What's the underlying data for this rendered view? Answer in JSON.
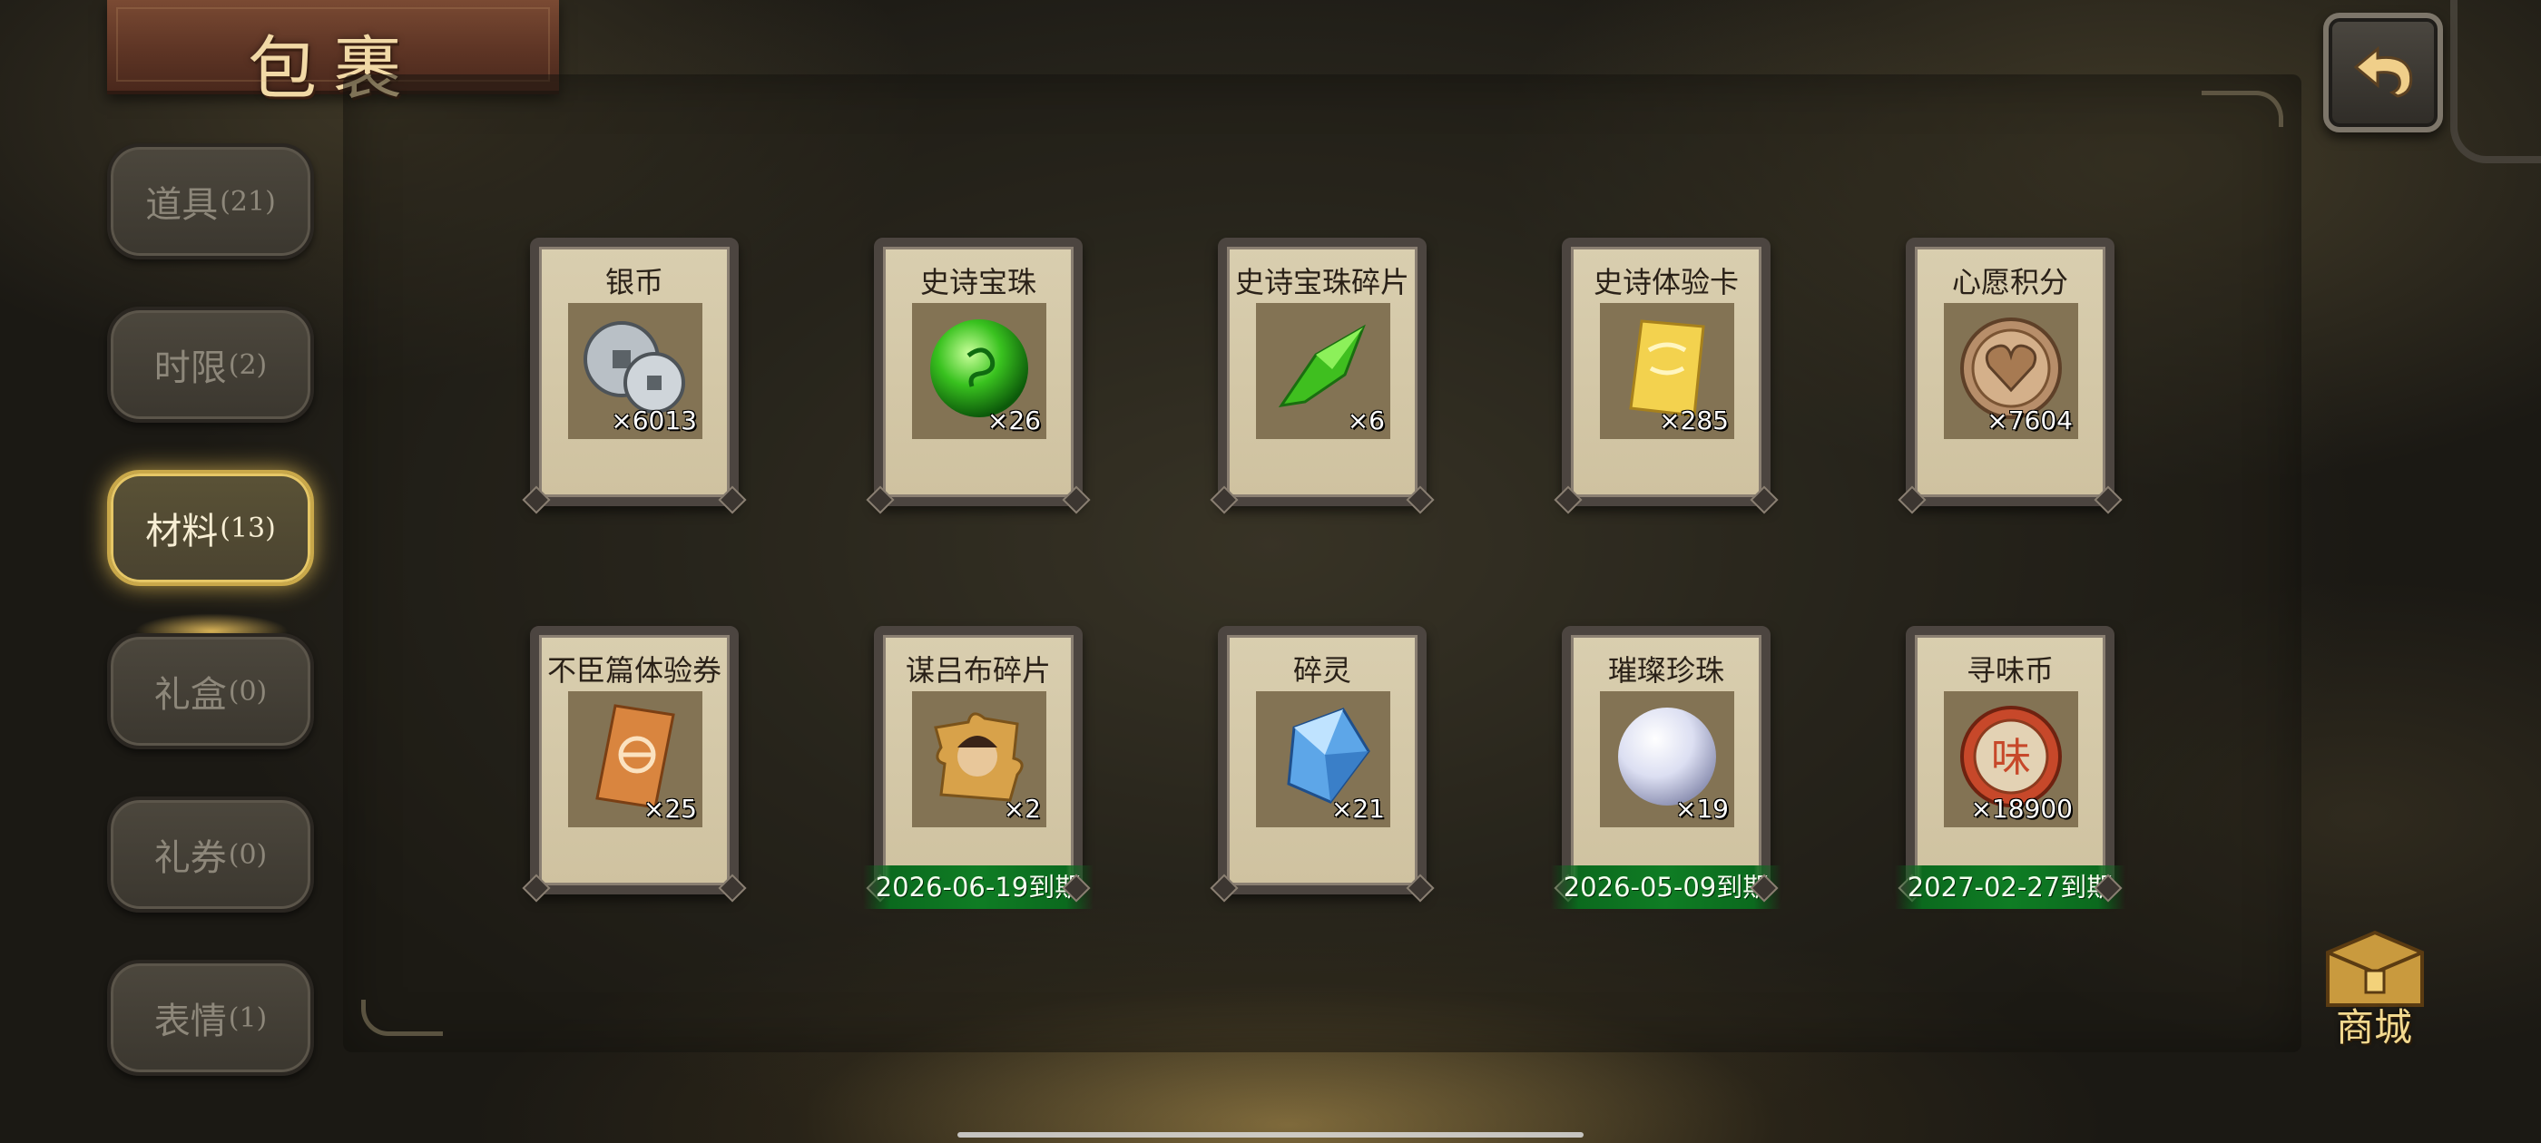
{
  "header": {
    "title": "包裹"
  },
  "tabs": [
    {
      "label": "道具",
      "count": "(21)",
      "active": false
    },
    {
      "label": "时限",
      "count": "(2)",
      "active": false
    },
    {
      "label": "材料",
      "count": "(13)",
      "active": true
    },
    {
      "label": "礼盒",
      "count": "(0)",
      "active": false
    },
    {
      "label": "礼券",
      "count": "(0)",
      "active": false
    },
    {
      "label": "表情",
      "count": "(1)",
      "active": false
    }
  ],
  "items": [
    {
      "name": "银币",
      "qty": "×6013",
      "icon": "silver-coin-icon"
    },
    {
      "name": "史诗宝珠",
      "qty": "×26",
      "icon": "green-orb-icon"
    },
    {
      "name": "史诗宝珠碎片",
      "qty": "×6",
      "icon": "green-shard-icon"
    },
    {
      "name": "史诗体验卡",
      "qty": "×285",
      "icon": "gold-card-icon"
    },
    {
      "name": "心愿积分",
      "qty": "×7604",
      "icon": "heart-coin-icon"
    },
    {
      "name": "不臣篇体验券",
      "qty": "×25",
      "icon": "ticket-icon"
    },
    {
      "name": "谋吕布碎片",
      "qty": "×2",
      "icon": "hero-fragment-icon",
      "expire": "2026-06-19到期"
    },
    {
      "name": "碎灵",
      "qty": "×21",
      "icon": "blue-crystal-icon"
    },
    {
      "name": "璀璨珍珠",
      "qty": "×19",
      "icon": "pearl-icon",
      "expire": "2026-05-09到期"
    },
    {
      "name": "寻味币",
      "qty": "×18900",
      "icon": "taste-coin-icon",
      "expire": "2027-02-27到期"
    }
  ],
  "shop": {
    "label": "商城"
  },
  "colors": {
    "active_tab_glow": "#e6c766",
    "expire_banner": "#0f7d24",
    "card_bg": "#d9ceaf",
    "title_text": "#f1d9a6"
  }
}
